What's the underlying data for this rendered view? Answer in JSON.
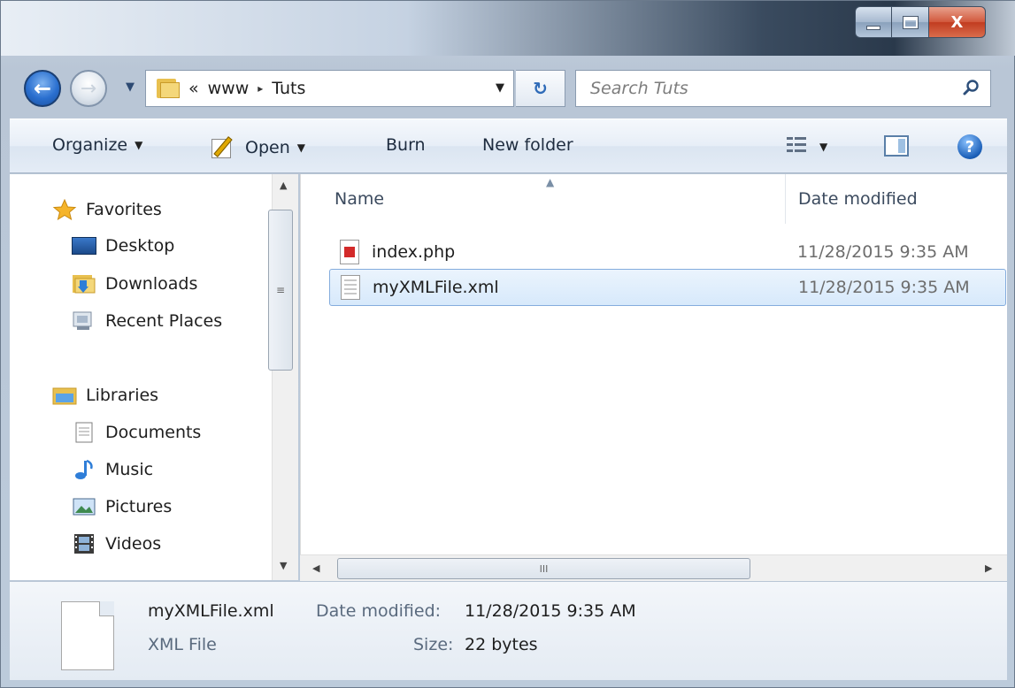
{
  "window": {
    "caption_buttons": {
      "minimize_icon": "minimize-icon",
      "maximize_icon": "maximize-icon",
      "close_glyph": "X"
    }
  },
  "nav": {
    "back_glyph": "←",
    "forward_glyph": "→",
    "breadcrumb": {
      "overflow": "«",
      "parts": [
        "www",
        "Tuts"
      ],
      "separator": "▸"
    },
    "address_dropdown": "▼",
    "refresh_glyph": "↻",
    "search_placeholder": "Search Tuts"
  },
  "commandbar": {
    "organize": "Organize",
    "open": "Open",
    "burn": "Burn",
    "new_folder": "New folder",
    "dropdown_glyph": "▼",
    "help_glyph": "?"
  },
  "sidebar": {
    "favorites": {
      "label": "Favorites",
      "items": [
        "Desktop",
        "Downloads",
        "Recent Places"
      ]
    },
    "libraries": {
      "label": "Libraries",
      "items": [
        "Documents",
        "Music",
        "Pictures",
        "Videos"
      ]
    }
  },
  "filelist": {
    "columns": {
      "name": "Name",
      "date_modified": "Date modified"
    },
    "sort_glyph": "▲",
    "files": [
      {
        "name": "index.php",
        "date": "11/28/2015 9:35 AM",
        "selected": false
      },
      {
        "name": "myXMLFile.xml",
        "date": "11/28/2015 9:35 AM",
        "selected": true
      }
    ]
  },
  "scrollbar": {
    "grip": "≡",
    "hgrip": "III"
  },
  "details": {
    "name": "myXMLFile.xml",
    "type": "XML File",
    "date_label": "Date modified:",
    "date_value": "11/28/2015 9:35 AM",
    "size_label": "Size:",
    "size_value": "22 bytes"
  }
}
